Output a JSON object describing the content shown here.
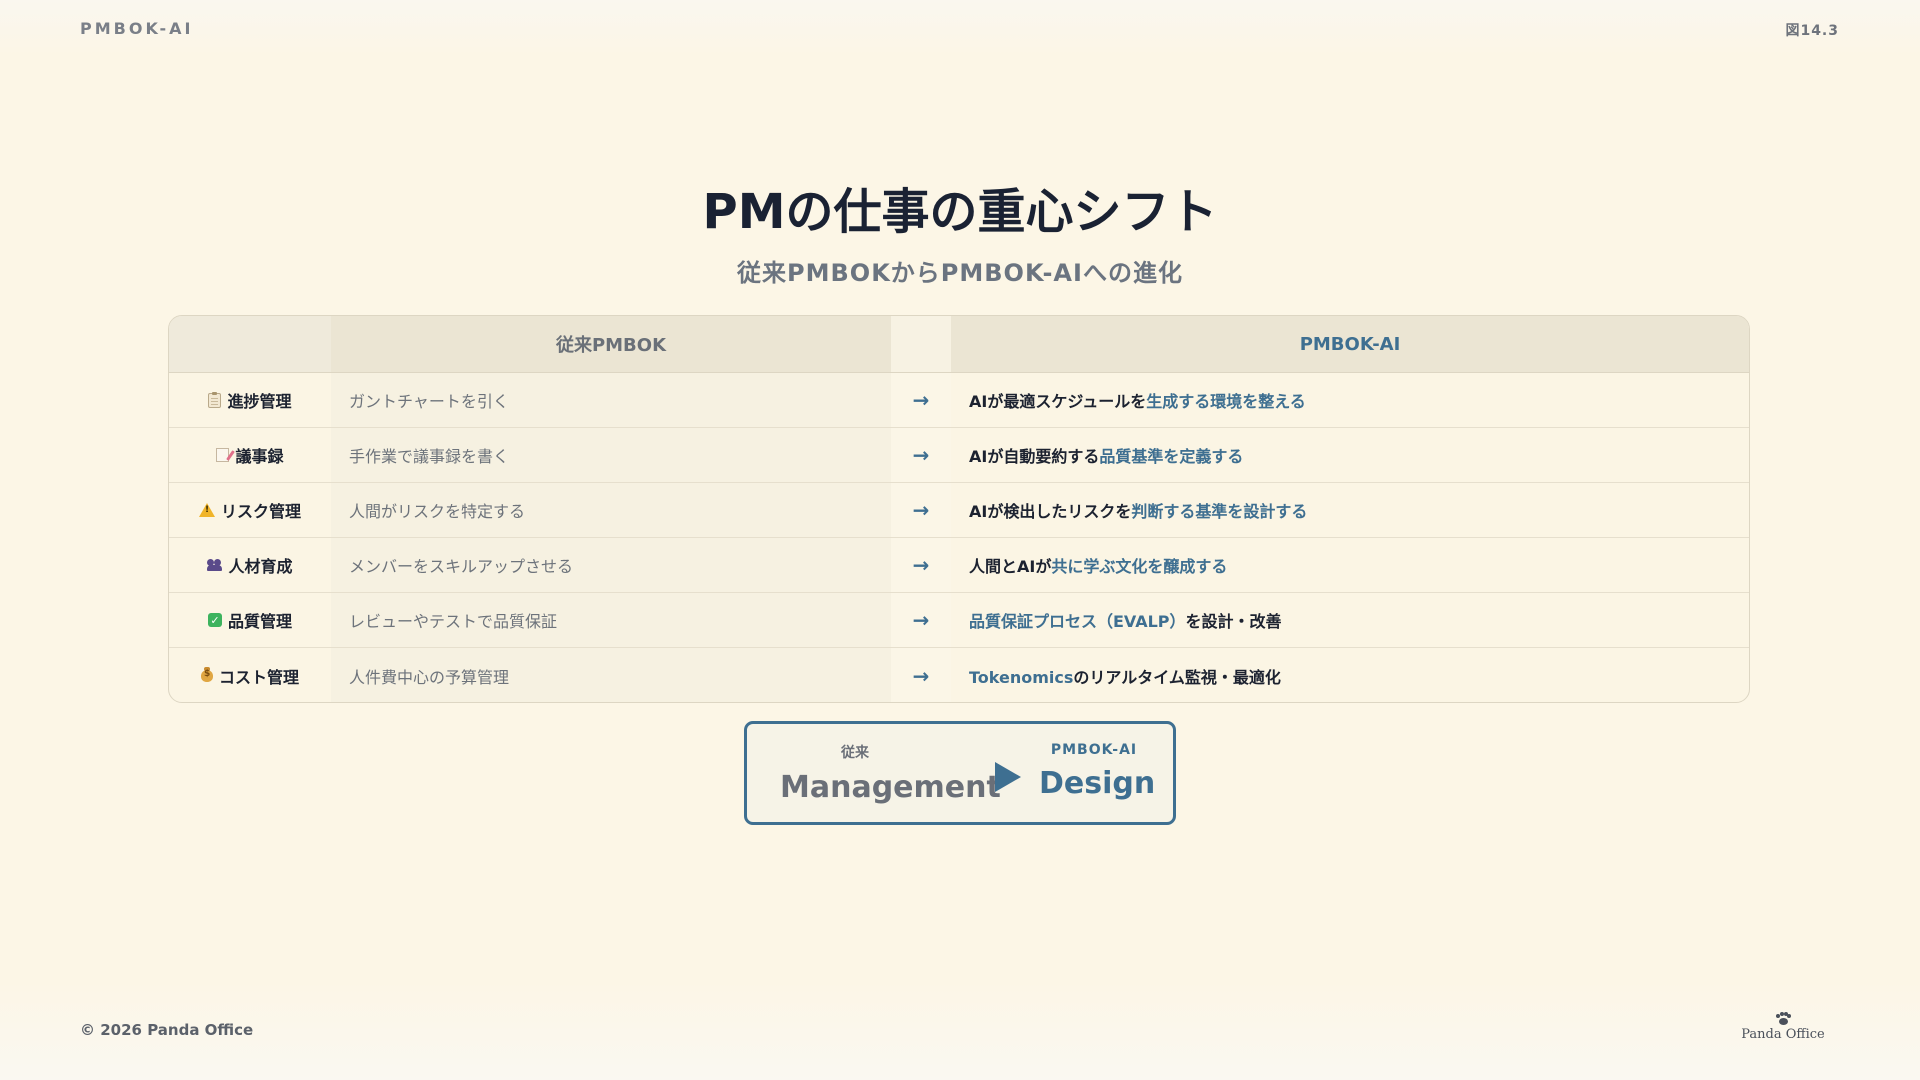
{
  "header": {
    "brand": "PMBOK-AI",
    "figure_number": "図14.3"
  },
  "title": "PMの仕事の重心シフト",
  "subtitle": "従来PMBOKからPMBOK-AIへの進化",
  "table": {
    "columns": {
      "traditional": "従来PMBOK",
      "ai": "PMBOK-AI"
    },
    "arrow": "→",
    "rows": [
      {
        "icon": "clipboard-icon",
        "category": "進捗管理",
        "traditional": "ガントチャートを引く",
        "ai_plain": "AIが最適スケジュールを",
        "ai_highlight": "生成する環境を整える",
        "ai_tail": ""
      },
      {
        "icon": "memo-icon",
        "category": "議事録",
        "traditional": "手作業で議事録を書く",
        "ai_plain": "AIが自動要約する",
        "ai_highlight": "品質基準を定義する",
        "ai_tail": ""
      },
      {
        "icon": "warning-icon",
        "category": "リスク管理",
        "traditional": "人間がリスクを特定する",
        "ai_plain": "AIが検出したリスクを",
        "ai_highlight": "判断する基準を設計する",
        "ai_tail": ""
      },
      {
        "icon": "people-icon",
        "category": "人材育成",
        "traditional": "メンバーをスキルアップさせる",
        "ai_plain": "人間とAIが",
        "ai_highlight": "共に学ぶ文化を醸成する",
        "ai_tail": ""
      },
      {
        "icon": "check-icon",
        "category": "品質管理",
        "traditional": "レビューやテストで品質保証",
        "ai_plain": "",
        "ai_highlight": "品質保証プロセス（EVALP）",
        "ai_tail": "を設計・改善"
      },
      {
        "icon": "money-bag-icon",
        "category": "コスト管理",
        "traditional": "人件費中心の予算管理",
        "ai_plain": "",
        "ai_highlight": "Tokenomics",
        "ai_tail": "のリアルタイム監視・最適化"
      }
    ]
  },
  "shift": {
    "from_caption": "従来",
    "from_label": "Management",
    "to_caption": "PMBOK-AI",
    "to_label": "Design"
  },
  "footer": {
    "copyright": "© 2026 Panda Office",
    "logo_text": "Panda Office"
  },
  "colors": {
    "accent": "#3e6f91",
    "background": "#fcf6e6",
    "heading": "#1a2233"
  }
}
